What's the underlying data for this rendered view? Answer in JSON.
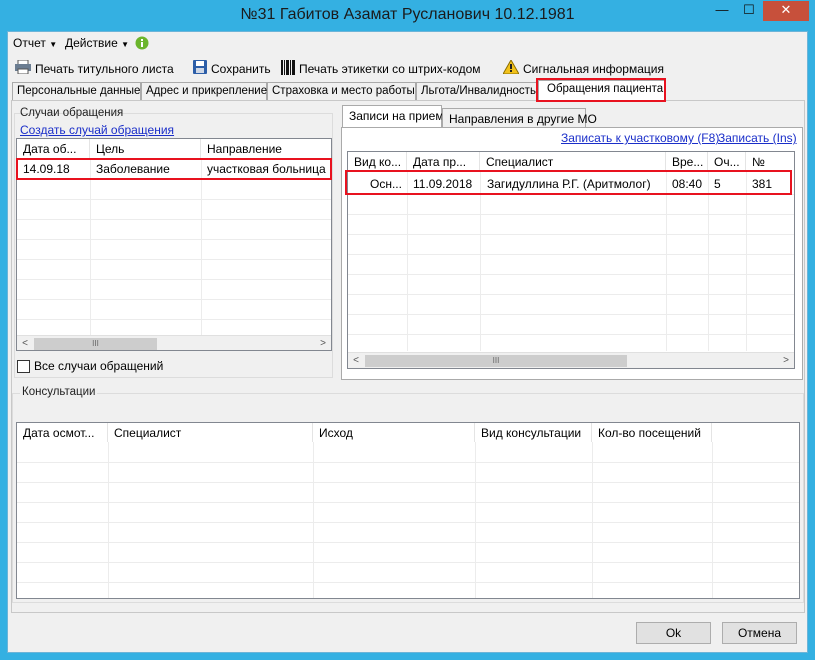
{
  "window": {
    "title": "№31 Габитов Азамат Русланович 10.12.1981",
    "controls": {
      "minimize": "—",
      "maximize": "☐",
      "close": "✕"
    }
  },
  "menu": {
    "report": "Отчет",
    "action": "Действие"
  },
  "toolbar": {
    "print_title": "Печать титульного листа",
    "save": "Сохранить",
    "print_barcode": "Печать этикетки со штрих-кодом",
    "signal_info": "Сигнальная информация"
  },
  "tabs": [
    {
      "label": "Персональные данные"
    },
    {
      "label": "Адрес и прикрепление"
    },
    {
      "label": "Страховка и место работы"
    },
    {
      "label": "Льгота/Инвалидность"
    },
    {
      "label": "Обращения пациента"
    }
  ],
  "cases": {
    "group_title": "Случаи обращения",
    "create_link": "Создать случай обращения",
    "columns": [
      "Дата об...",
      "Цель",
      "Направление"
    ],
    "rows": [
      {
        "date": "14.09.18",
        "goal": "Заболевание",
        "direction": "участковая больница"
      }
    ],
    "all_cases_label": "Все случаи обращений",
    "all_cases_checked": false
  },
  "appointments": {
    "tabs": [
      "Записи на прием",
      "Направления в другие МО"
    ],
    "link_district": "Записать к участковому (F8)",
    "link_ins": "Записать (Ins)",
    "columns": [
      "Вид ко...",
      "Дата пр...",
      "Специалист",
      "Вре...",
      "Оч...",
      "№"
    ],
    "rows": [
      {
        "type": "Осн...",
        "date": "11.09.2018",
        "specialist": "Загидуллина Р.Г. (Аритмолог)",
        "time": "08:40",
        "queue": "5",
        "number": "381"
      }
    ]
  },
  "consultations": {
    "group_title": "Консультации",
    "columns": [
      "Дата осмот...",
      "Специалист",
      "Исход",
      "Вид консультации",
      "Кол-во посещений"
    ]
  },
  "scrollbar": {
    "left_arrow": "<",
    "right_arrow": ">",
    "thumb_grip": "III"
  },
  "footer": {
    "ok": "Ok",
    "cancel": "Отмена"
  },
  "colors": {
    "titlebar": "#34b0e2",
    "highlight": "#e8121f",
    "link": "#1a2ec9",
    "close_button": "#c7503b"
  }
}
